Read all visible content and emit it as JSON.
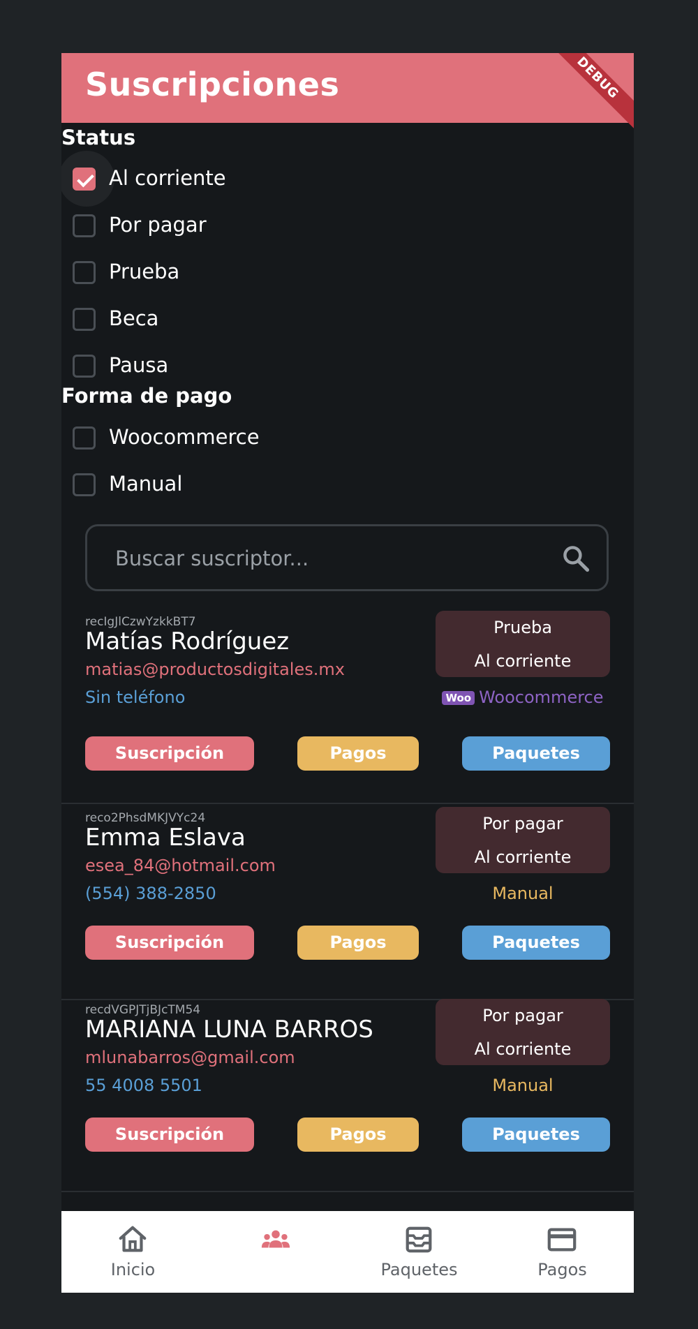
{
  "appbar": {
    "title": "Suscripciones",
    "debug": "DEBUG"
  },
  "filters": {
    "status_title": "Status",
    "status_options": [
      {
        "label": "Al corriente",
        "checked": true
      },
      {
        "label": "Por pagar",
        "checked": false
      },
      {
        "label": "Prueba",
        "checked": false
      },
      {
        "label": "Beca",
        "checked": false
      },
      {
        "label": "Pausa",
        "checked": false
      }
    ],
    "payment_title": "Forma de pago",
    "payment_options": [
      {
        "label": "Woocommerce",
        "checked": false
      },
      {
        "label": "Manual",
        "checked": false
      }
    ]
  },
  "search": {
    "placeholder": "Buscar suscriptor...",
    "icon": "search-icon"
  },
  "subscribers": [
    {
      "id": "recIgJlCzwYzkkBT7",
      "name": "Matías Rodríguez",
      "email": "matias@productosdigitales.mx",
      "phone": "Sin teléfono",
      "plan": "Prueba",
      "status": "Al corriente",
      "payment_method": "Woocommerce",
      "payment_logo": "Woo",
      "buttons": {
        "subscription": "Suscripción",
        "payments": "Pagos",
        "packages": "Paquetes"
      }
    },
    {
      "id": "reco2PhsdMKJVYc24",
      "name": "Emma Eslava",
      "email": "esea_84@hotmail.com",
      "phone": "(554) 388-2850",
      "plan": "Por pagar",
      "status": "Al corriente",
      "payment_method": "Manual",
      "buttons": {
        "subscription": "Suscripción",
        "payments": "Pagos",
        "packages": "Paquetes"
      }
    },
    {
      "id": "recdVGPJTjBJcTM54",
      "name": "MARIANA LUNA BARROS",
      "email": "mlunabarros@gmail.com",
      "phone": "55 4008 5501",
      "plan": "Por pagar",
      "status": "Al corriente",
      "payment_method": "Manual",
      "buttons": {
        "subscription": "Suscripción",
        "payments": "Pagos",
        "packages": "Paquetes"
      }
    }
  ],
  "bottom_nav": [
    {
      "label": "Inicio",
      "icon": "home-icon"
    },
    {
      "label": "",
      "icon": "people-icon",
      "active": true
    },
    {
      "label": "Paquetes",
      "icon": "inbox-icon"
    },
    {
      "label": "Pagos",
      "icon": "credit-card-icon"
    }
  ],
  "colors": {
    "accent": "#e0717b",
    "payments": "#e8b860",
    "packages": "#5a9fd6",
    "woocommerce": "#8d63c4",
    "background": "#15181b"
  }
}
